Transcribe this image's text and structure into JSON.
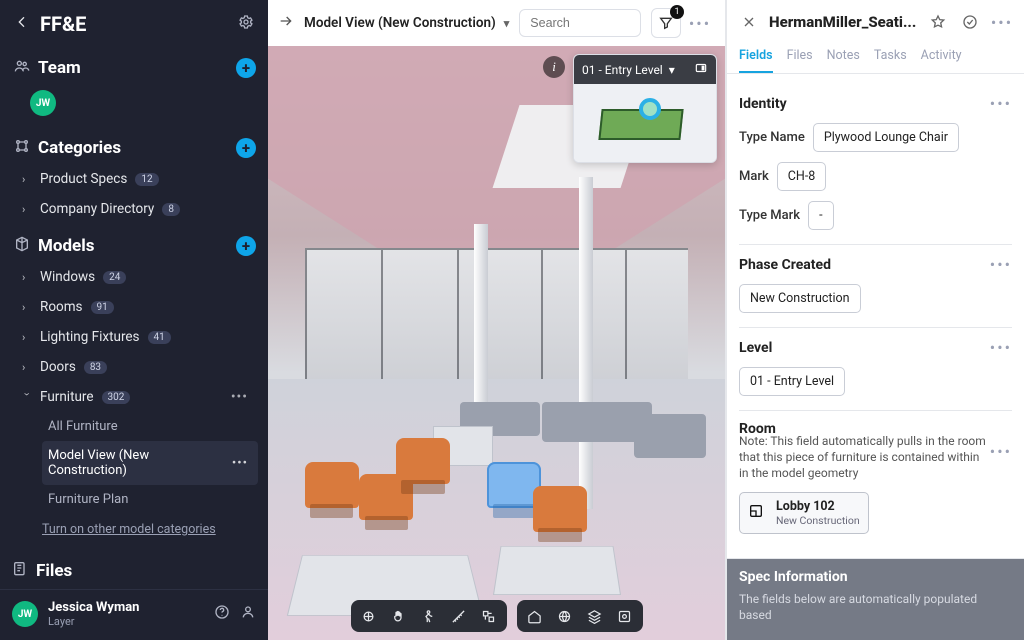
{
  "sidebar": {
    "app_title": "FF&E",
    "team": {
      "title": "Team",
      "avatar_initials": "JW"
    },
    "categories": {
      "title": "Categories",
      "items": [
        {
          "label": "Product Specs",
          "count": "12"
        },
        {
          "label": "Company Directory",
          "count": "8"
        }
      ]
    },
    "models": {
      "title": "Models",
      "items": [
        {
          "label": "Windows",
          "count": "24"
        },
        {
          "label": "Rooms",
          "count": "91"
        },
        {
          "label": "Lighting Fixtures",
          "count": "41"
        },
        {
          "label": "Doors",
          "count": "83"
        },
        {
          "label": "Furniture",
          "count": "302"
        }
      ],
      "furniture_subs": [
        {
          "label": "All Furniture"
        },
        {
          "label": "Model View (New Construction)"
        },
        {
          "label": "Furniture Plan"
        }
      ],
      "link": "Turn on other model categories"
    },
    "files": {
      "title": "Files"
    },
    "footer": {
      "name": "Jessica Wyman",
      "sub": "Layer"
    }
  },
  "toolbar": {
    "breadcrumb": "Model View (New Construction)",
    "search_placeholder": "Search",
    "filter_badge": "1"
  },
  "viewer": {
    "level_label": "01 - Entry Level"
  },
  "panel": {
    "title": "HermanMiller_Seati...",
    "tabs": [
      "Fields",
      "Files",
      "Notes",
      "Tasks",
      "Activity"
    ],
    "identity": {
      "title": "Identity",
      "type_name_label": "Type Name",
      "type_name_value": "Plywood Lounge Chair",
      "mark_label": "Mark",
      "mark_value": "CH-8",
      "type_mark_label": "Type Mark",
      "type_mark_value": "-"
    },
    "phase": {
      "title": "Phase Created",
      "value": "New Construction"
    },
    "level": {
      "title": "Level",
      "value": "01 - Entry Level"
    },
    "room": {
      "title": "Room",
      "note": "Note: This field automatically pulls in the room that this piece of furniture is contained within in the model geometry",
      "chip_name": "Lobby 102",
      "chip_sub": "New Construction"
    },
    "spec": {
      "title": "Spec Information",
      "note": "The fields below are automatically populated based"
    }
  }
}
